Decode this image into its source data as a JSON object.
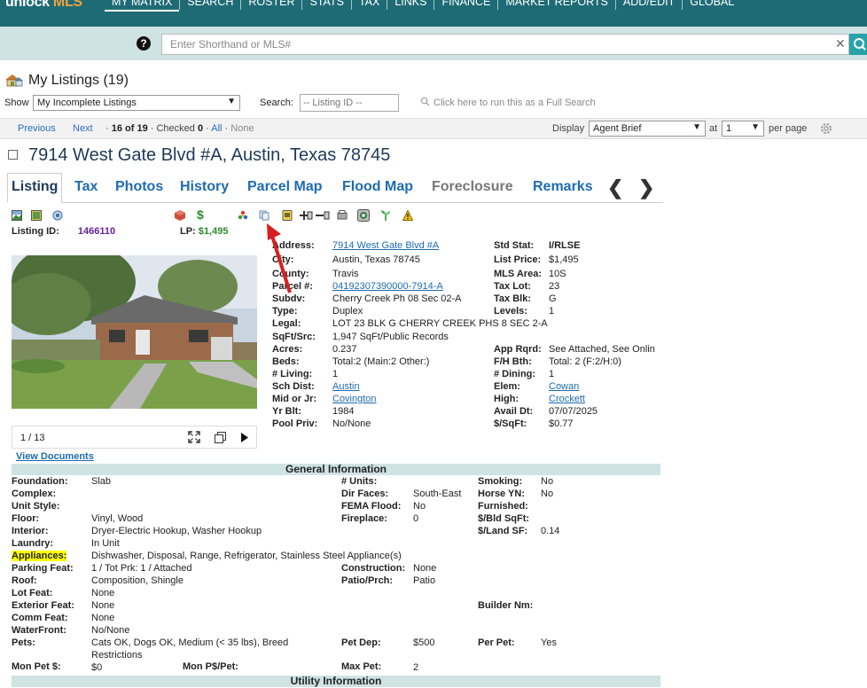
{
  "brand": {
    "part1": "unlock",
    "part2": "MLS"
  },
  "nav": [
    "MY MATRIX",
    "SEARCH",
    "ROSTER",
    "STATS",
    "TAX",
    "LINKS",
    "FINANCE",
    "MARKET REPORTS",
    "ADD/EDIT",
    "GLOBAL"
  ],
  "search": {
    "placeholder": "Enter Shorthand or MLS#"
  },
  "listings": {
    "title": "My Listings (19)",
    "show_label": "Show",
    "show_value": "My Incomplete Listings",
    "search_label": "Search:",
    "search_placeholder": "-- Listing ID --",
    "run_full_search": "Click here to run this as a Full Search"
  },
  "pager": {
    "previous": "Previous",
    "next": "Next",
    "position": "16 of 19",
    "checked_label": "Checked",
    "checked_count": "0",
    "all": "All",
    "none": "None",
    "display_label": "Display",
    "display_value": "Agent Brief",
    "at_label": "at",
    "at_value": "1",
    "per_page": "per page"
  },
  "listing": {
    "address_title": "7914 West Gate Blvd #A, Austin, Texas 78745",
    "tabs": [
      "Listing",
      "Tax",
      "Photos",
      "History",
      "Parcel Map",
      "Flood Map",
      "Foreclosure",
      "Remarks"
    ],
    "listing_id_label": "Listing ID:",
    "listing_id": "1466110",
    "lp_label": "LP:",
    "lp": "$1,495",
    "photo_counter": "1 / 13",
    "view_documents": "View Documents"
  },
  "details_left": [
    {
      "label": "Address:",
      "value": "7914 West Gate Blvd #A",
      "link": true
    },
    {
      "label": "City:",
      "value": "Austin, Texas 78745"
    },
    {
      "label": "County:",
      "value": "Travis"
    },
    {
      "label": "Parcel #:",
      "value": "04192307390000-7914-A",
      "link": true
    },
    {
      "label": "Subdv:",
      "value": "Cherry Creek Ph 08 Sec 02-A"
    },
    {
      "label": "Type:",
      "value": "Duplex"
    },
    {
      "label": "Legal:",
      "value": "LOT 23 BLK G CHERRY CREEK PHS 8 SEC 2-A"
    },
    {
      "label": "SqFt/Src:",
      "value": "1,947 SqFt/Public Records"
    },
    {
      "label": "Acres:",
      "value": "0.237"
    },
    {
      "label": "Beds:",
      "value": "Total:2 (Main:2 Other:)"
    },
    {
      "label": "# Living:",
      "value": "1"
    },
    {
      "label": "Sch Dist:",
      "value": "Austin",
      "link": true
    },
    {
      "label": "Mid or Jr:",
      "value": "Covington",
      "link": true
    },
    {
      "label": "Yr Blt:",
      "value": "1984"
    },
    {
      "label": "Pool Priv:",
      "value": "No/None"
    }
  ],
  "details_right": [
    {
      "label": "Std Stat:",
      "value": "I/RLSE",
      "bold": true
    },
    {
      "label": "List Price:",
      "value": "$1,495"
    },
    {
      "label": "MLS Area:",
      "value": "10S"
    },
    {
      "label": "Tax Lot:",
      "value": "23"
    },
    {
      "label": "Tax Blk:",
      "value": "G"
    },
    {
      "label": "Levels:",
      "value": "1"
    },
    {
      "label": "",
      "value": ""
    },
    {
      "label": "",
      "value": ""
    },
    {
      "label": "App Rqrd:",
      "value": "See Attached, See Onlin"
    },
    {
      "label": "F/H Bth:",
      "value": "Total: 2 (F:2/H:0)"
    },
    {
      "label": "# Dining:",
      "value": "1"
    },
    {
      "label": "Elem:",
      "value": "Cowan",
      "link": true
    },
    {
      "label": "High:",
      "value": "Crockett",
      "link": true
    },
    {
      "label": "Avail Dt:",
      "value": "07/07/2025"
    },
    {
      "label": "$/SqFt:",
      "value": "$0.77"
    }
  ],
  "general": {
    "header": "General Information",
    "col1": [
      {
        "label": "Foundation:",
        "value": "Slab"
      },
      {
        "label": "Complex:",
        "value": ""
      },
      {
        "label": "Unit Style:",
        "value": ""
      },
      {
        "label": "Floor:",
        "value": "Vinyl, Wood"
      },
      {
        "label": "Interior:",
        "value": "Dryer-Electric Hookup, Washer Hookup"
      },
      {
        "label": "Laundry:",
        "value": "In Unit"
      },
      {
        "label": "Appliances:",
        "value": "Dishwasher, Disposal, Range, Refrigerator, Stainless Steel Appliance(s)"
      },
      {
        "label": "Parking Feat:",
        "value": "1 / Tot Prk: 1 / Attached"
      },
      {
        "label": "Roof:",
        "value": "Composition, Shingle"
      },
      {
        "label": "Lot Feat:",
        "value": "None"
      },
      {
        "label": "Exterior Feat:",
        "value": "None"
      },
      {
        "label": "Comm Feat:",
        "value": "None"
      },
      {
        "label": "WaterFront:",
        "value": "No/None"
      },
      {
        "label": "Pets:",
        "value": "Cats OK, Dogs OK, Medium (< 35 lbs), Breed"
      },
      {
        "label": "",
        "value": "Restrictions"
      },
      {
        "label": "Mon Pet $:",
        "value": "$0"
      }
    ],
    "col2": [
      {
        "label": "# Units:",
        "value": ""
      },
      {
        "label": "Dir Faces:",
        "value": "South-East"
      },
      {
        "label": "FEMA Flood:",
        "value": "No"
      },
      {
        "label": "Fireplace:",
        "value": "0"
      },
      {
        "label": "Construction:",
        "value": "None"
      },
      {
        "label": "Patio/Prch:",
        "value": "Patio"
      },
      {
        "label": "Pet Dep:",
        "value": "$500"
      },
      {
        "label": "Max Pet:",
        "value": "2"
      }
    ],
    "col3": [
      {
        "label": "Smoking:",
        "value": "No"
      },
      {
        "label": "Horse YN:",
        "value": "No"
      },
      {
        "label": "Furnished:",
        "value": ""
      },
      {
        "label": "$/Bld SqFt:",
        "value": ""
      },
      {
        "label": "$/Land SF:",
        "value": "0.14"
      },
      {
        "label": "Builder Nm:",
        "value": ""
      },
      {
        "label": "Per Pet:",
        "value": "Yes"
      }
    ],
    "mon_pds_label": "Mon P$/Pet:"
  },
  "utility": {
    "header": "Utility Information"
  }
}
